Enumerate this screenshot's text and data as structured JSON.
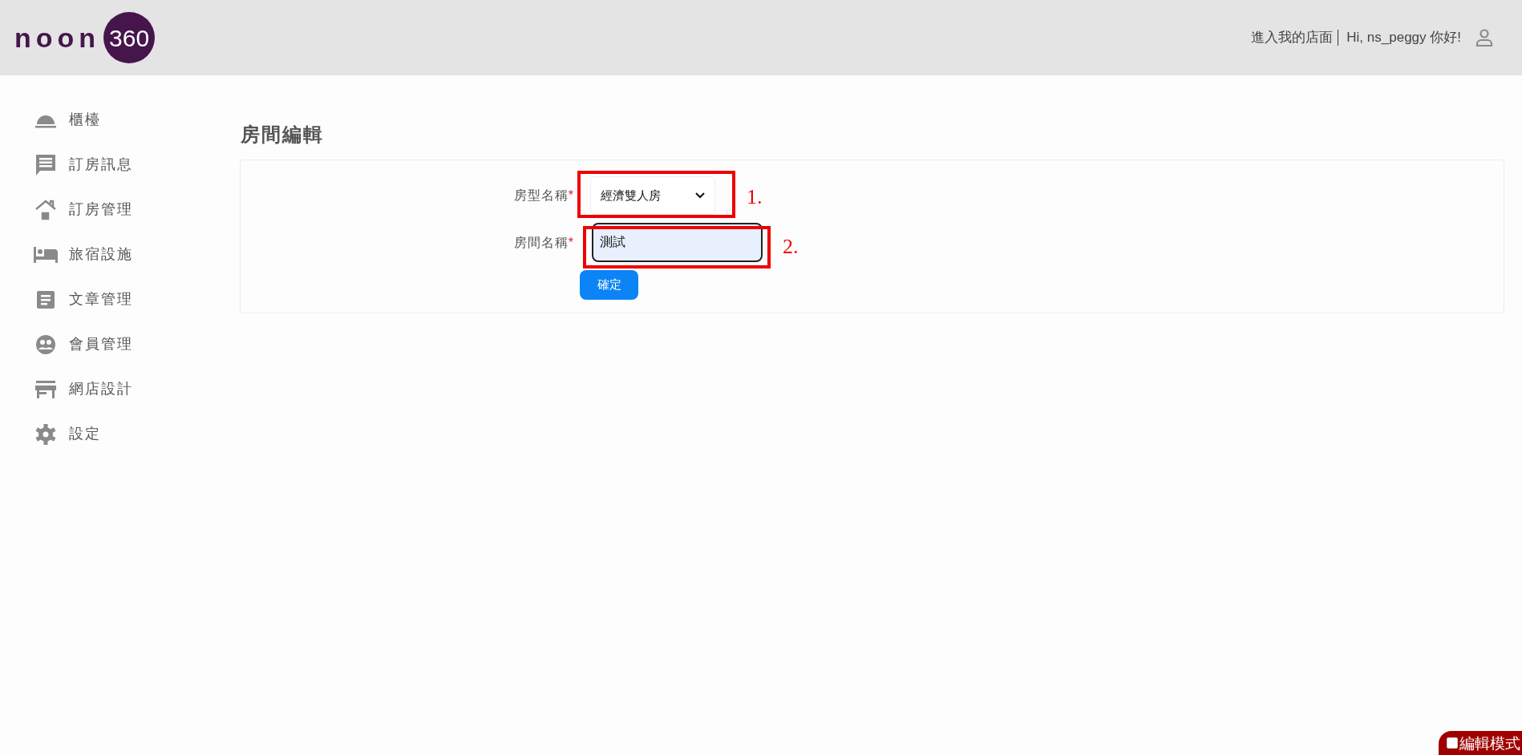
{
  "header": {
    "logo": {
      "word": "noon",
      "badge": "360"
    },
    "store_link": "進入我的店面",
    "greeting": "Hi, ns_peggy 你好!"
  },
  "sidebar": {
    "items": [
      {
        "label": "櫃檯"
      },
      {
        "label": "訂房訊息"
      },
      {
        "label": "訂房管理"
      },
      {
        "label": "旅宿設施"
      },
      {
        "label": "文章管理"
      },
      {
        "label": "會員管理"
      },
      {
        "label": "網店設計"
      },
      {
        "label": "設定"
      }
    ]
  },
  "page_title": "房間編輯",
  "form": {
    "fields": [
      {
        "kind": "select",
        "label": "房型名稱",
        "required_mark": "*",
        "value": "經濟雙人房",
        "annotation": "1."
      },
      {
        "kind": "text",
        "label": "房間名稱",
        "required_mark": "*",
        "value": "測試",
        "annotation": "2."
      }
    ],
    "submit": "確定"
  },
  "edit_mode": {
    "label": "編輯模式",
    "checked": false
  }
}
